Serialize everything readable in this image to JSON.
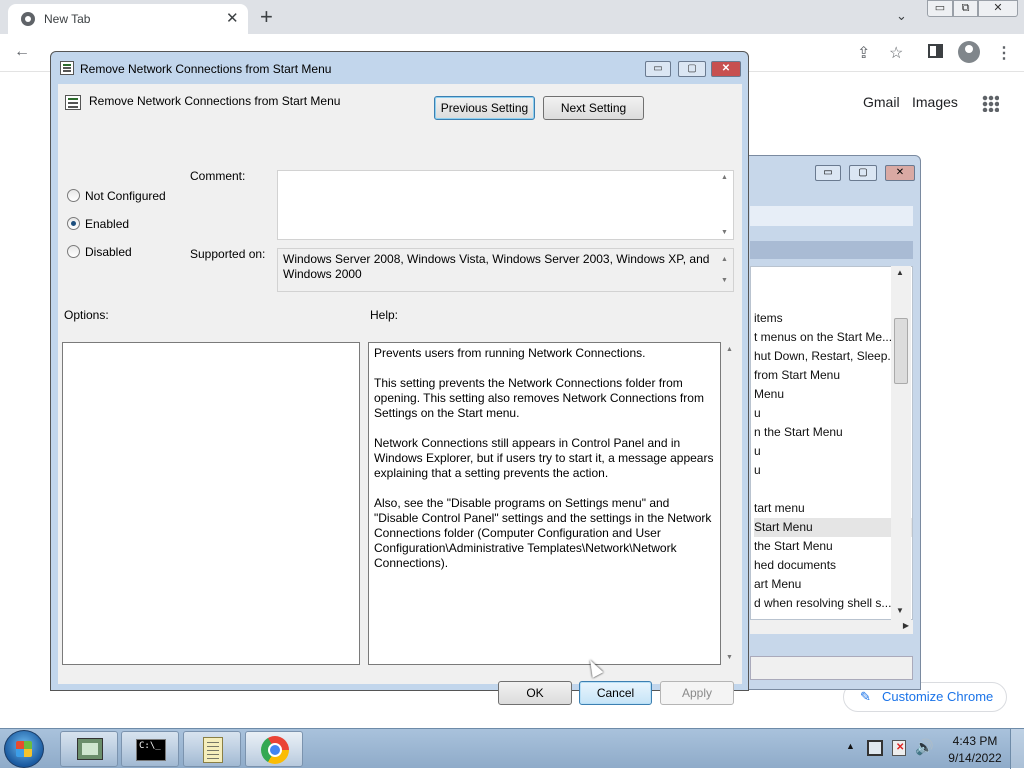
{
  "browser": {
    "tab_title": "New Tab",
    "tab_close": "✕",
    "new_tab": "+",
    "tab_search": "⌄",
    "window_min": "▭",
    "window_max": "⧉",
    "window_close": "✕",
    "gmail": "Gmail",
    "images": "Images",
    "customize_chrome": "Customize Chrome",
    "icons": [
      "chrome-logo-icon",
      "back-arrow-icon",
      "share-icon",
      "star-icon",
      "side-panel-icon",
      "profile-icon",
      "menu-icon",
      "apps-grid-icon",
      "pencil-icon"
    ]
  },
  "bg_window": {
    "list_items": [
      "items",
      "t menus on the Start Me...",
      "hut Down, Restart, Sleep...",
      "from Start Menu",
      "Menu",
      "u",
      "n the Start Menu",
      "u",
      "u",
      "",
      "tart menu",
      " Start Menu",
      "the Start Menu",
      "hed documents",
      "art Menu",
      "d when resolving shell s..."
    ],
    "selected_index": 11
  },
  "dialog": {
    "title": "Remove Network Connections from Start Menu",
    "policy_name": "Remove Network Connections from Start Menu",
    "prev_setting": "Previous Setting",
    "next_setting": "Next Setting",
    "radio_not_configured": "Not Configured",
    "radio_enabled": "Enabled",
    "radio_disabled": "Disabled",
    "selected_option": "Enabled",
    "comment_label": "Comment:",
    "comment_value": "",
    "supported_label": "Supported on:",
    "supported_value": "Windows Server 2008, Windows Vista, Windows Server 2003, Windows XP, and Windows 2000",
    "options_label": "Options:",
    "help_label": "Help:",
    "help_p1": "Prevents users from running Network Connections.",
    "help_p2": "This setting prevents the Network Connections folder from opening. This setting also removes Network Connections from Settings on the Start menu.",
    "help_p3": "Network Connections still appears in Control Panel and in Windows Explorer, but if users try to start it, a message appears explaining that a setting prevents the action.",
    "help_p4": "Also, see the \"Disable programs on Settings menu\" and \"Disable Control Panel\" settings and the settings in the Network Connections folder (Computer Configuration and User Configuration\\Administrative Templates\\Network\\Network Connections).",
    "ok": "OK",
    "cancel": "Cancel",
    "apply": "Apply",
    "min": "▭",
    "max": "▢",
    "close": "✕"
  },
  "taskbar": {
    "cmd_text": "C:\\_",
    "time": "4:43 PM",
    "date": "9/14/2022",
    "tray_arrow": "▲",
    "volume": "🔊"
  }
}
